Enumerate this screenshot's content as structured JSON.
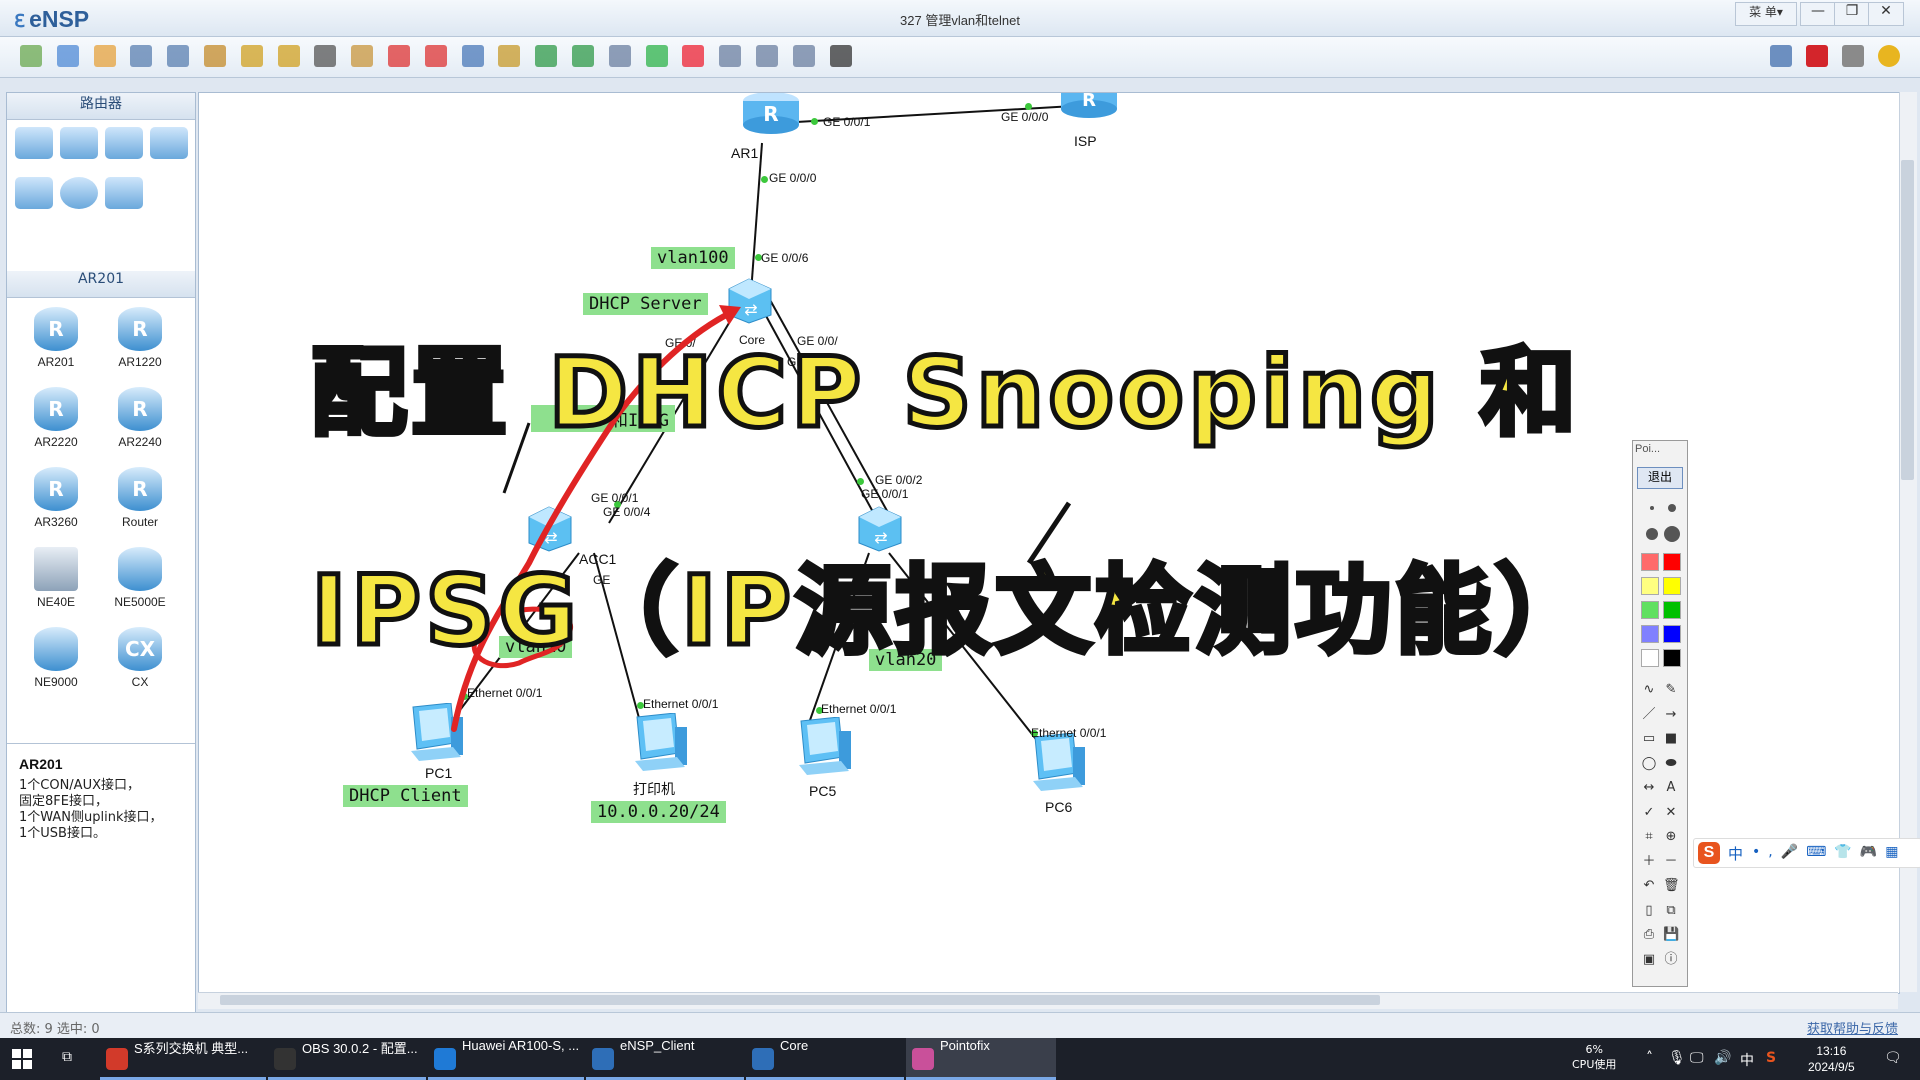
{
  "app": {
    "logo": "eNSP",
    "window_title": "327 管理vlan和telnet",
    "menu_label": "菜 单▾",
    "min_glyph": "—",
    "max_glyph": "❐",
    "close_glyph": "✕"
  },
  "toolbar": {
    "icons": [
      "new-topo-icon",
      "new-lab-icon",
      "open-icon",
      "save-icon",
      "save-as-icon",
      "print-icon",
      "undo-icon",
      "redo-icon",
      "select-icon",
      "hand-icon",
      "delete-icon",
      "delete-link-icon",
      "text-icon",
      "rectangle-icon",
      "zoom-in-icon",
      "zoom-out-icon",
      "fit-icon",
      "start-icon",
      "stop-icon",
      "capture-icon",
      "topology-icon",
      "grid-icon",
      "terminal-icon"
    ],
    "right_icons": [
      "chat-icon",
      "huawei-icon",
      "settings-icon",
      "help-icon"
    ]
  },
  "left_panel": {
    "category_header": "路由器",
    "category_icons": [
      "router-category-icon",
      "switch-category-icon",
      "wireless-category-icon",
      "firewall-category-icon",
      "pc-category-icon",
      "cloud-category-icon",
      "link-category-icon"
    ],
    "device_header": "AR201",
    "devices": [
      {
        "label": "AR201",
        "icon": "router-icon"
      },
      {
        "label": "AR1220",
        "icon": "router-icon"
      },
      {
        "label": "AR2220",
        "icon": "router-icon"
      },
      {
        "label": "AR2240",
        "icon": "router-icon"
      },
      {
        "label": "AR3260",
        "icon": "router-icon"
      },
      {
        "label": "Router",
        "icon": "router-icon"
      },
      {
        "label": "NE40E",
        "icon": "ne-chassis-icon"
      },
      {
        "label": "NE5000E",
        "icon": "ne-cylinder-icon"
      },
      {
        "label": "NE9000",
        "icon": "ne-router-icon"
      },
      {
        "label": "CX",
        "icon": "cx-router-icon"
      }
    ],
    "description_title": "AR201",
    "description_lines": [
      "1个CON/AUX接口，",
      "固定8FE接口，",
      "1个WAN侧uplink接口，",
      "1个USB接口。"
    ]
  },
  "topology": {
    "nodes": {
      "ar1": "AR1",
      "isp": "ISP",
      "core": "Core",
      "acc1": "ACC1",
      "pc1": "PC1",
      "printer": "打印机",
      "pc5": "PC5",
      "pc6": "PC6"
    },
    "ports": {
      "ar1_ge001": "GE 0/0/1",
      "isp_ge000": "GE 0/0/0",
      "ar1_ge000": "GE 0/0/0",
      "core_ge006": "GE 0/0/6",
      "core_ge_a": "GE 0/",
      "core_ge_b": "GE 0/0/",
      "core_ge_c": "GE",
      "acc1_ge001": "GE 0/0/1",
      "acc1_ge004": "GE 0/0/4",
      "acc1_ge": "GE",
      "acc2_ge002": "GE 0/0/2",
      "acc2_ge001": "GE 0/0/1",
      "pc1_eth": "Ethernet 0/0/1",
      "printer_eth": "Ethernet 0/0/1",
      "pc5_eth": "Ethernet 0/0/1",
      "pc6_eth": "Ethernet 0/0/1"
    },
    "tags": {
      "vlan100": "vlan100",
      "dhcp_server": "DHCP Server",
      "ipsg_fragment": "和IPSG",
      "vlan10": "vlan10",
      "vlan20": "vlan20",
      "dhcp_client": "DHCP Client",
      "printer_ip": "10.0.0.20/24"
    }
  },
  "overlay": {
    "line1": "配置 DHCP Snooping 和",
    "line2": "IPSG（IP源报文检测功能）",
    "text_color": "#f5e642",
    "outline_color": "#111111",
    "annotation_color": "#e02424"
  },
  "pointofix": {
    "title": "Poi...",
    "exit_label": "退出",
    "colors": [
      "#ff6a6a",
      "#ff0000",
      "#ffff80",
      "#ffff00",
      "#60e060",
      "#00c000",
      "#8080ff",
      "#0000ff",
      "#ffffff",
      "#000000"
    ],
    "tools": [
      "freehand-icon",
      "eraser-icon",
      "line-icon",
      "arrow-icon",
      "rect-icon",
      "filled-rect-icon",
      "ellipse-icon",
      "filled-ellipse-icon",
      "double-arrow-icon",
      "text-tool-icon",
      "check-icon",
      "cross-icon",
      "crop-icon",
      "magnify-icon",
      "plus-icon",
      "minus-icon",
      "undo-tool-icon",
      "trash-icon",
      "new-page-icon",
      "copy-icon",
      "print-tool-icon",
      "save-tool-icon",
      "screen-icon",
      "info-icon"
    ],
    "tool_glyphs": [
      "∿",
      "✎",
      "／",
      "→",
      "▭",
      "■",
      "◯",
      "⬬",
      "↔",
      "A",
      "✓",
      "✕",
      "⌗",
      "⊕",
      "＋",
      "－",
      "↶",
      "🗑",
      "▯",
      "⧉",
      "⎙",
      "💾",
      "▣",
      "ⓘ"
    ]
  },
  "ime": {
    "logo": "S",
    "lang": "中"
  },
  "statusbar": {
    "left": "总数: 9 选中: 0",
    "help": "获取帮助与反馈"
  },
  "taskbar": {
    "items": [
      {
        "label": "S系列交换机 典型...",
        "color": "#d23a2a"
      },
      {
        "label": "OBS 30.0.2 - 配置...",
        "color": "#333333"
      },
      {
        "label": "Huawei AR100-S, ...",
        "color": "#1f7ad6"
      },
      {
        "label": "eNSP_Client",
        "color": "#2e6eb7"
      },
      {
        "label": "Core",
        "color": "#2e6eb7"
      },
      {
        "label": "Pointofix",
        "color": "#c9509a"
      }
    ],
    "cpu_percent": "6%",
    "cpu_label": "CPU使用",
    "ime_lang": "中",
    "time": "13:16",
    "date": "2024/9/5"
  }
}
